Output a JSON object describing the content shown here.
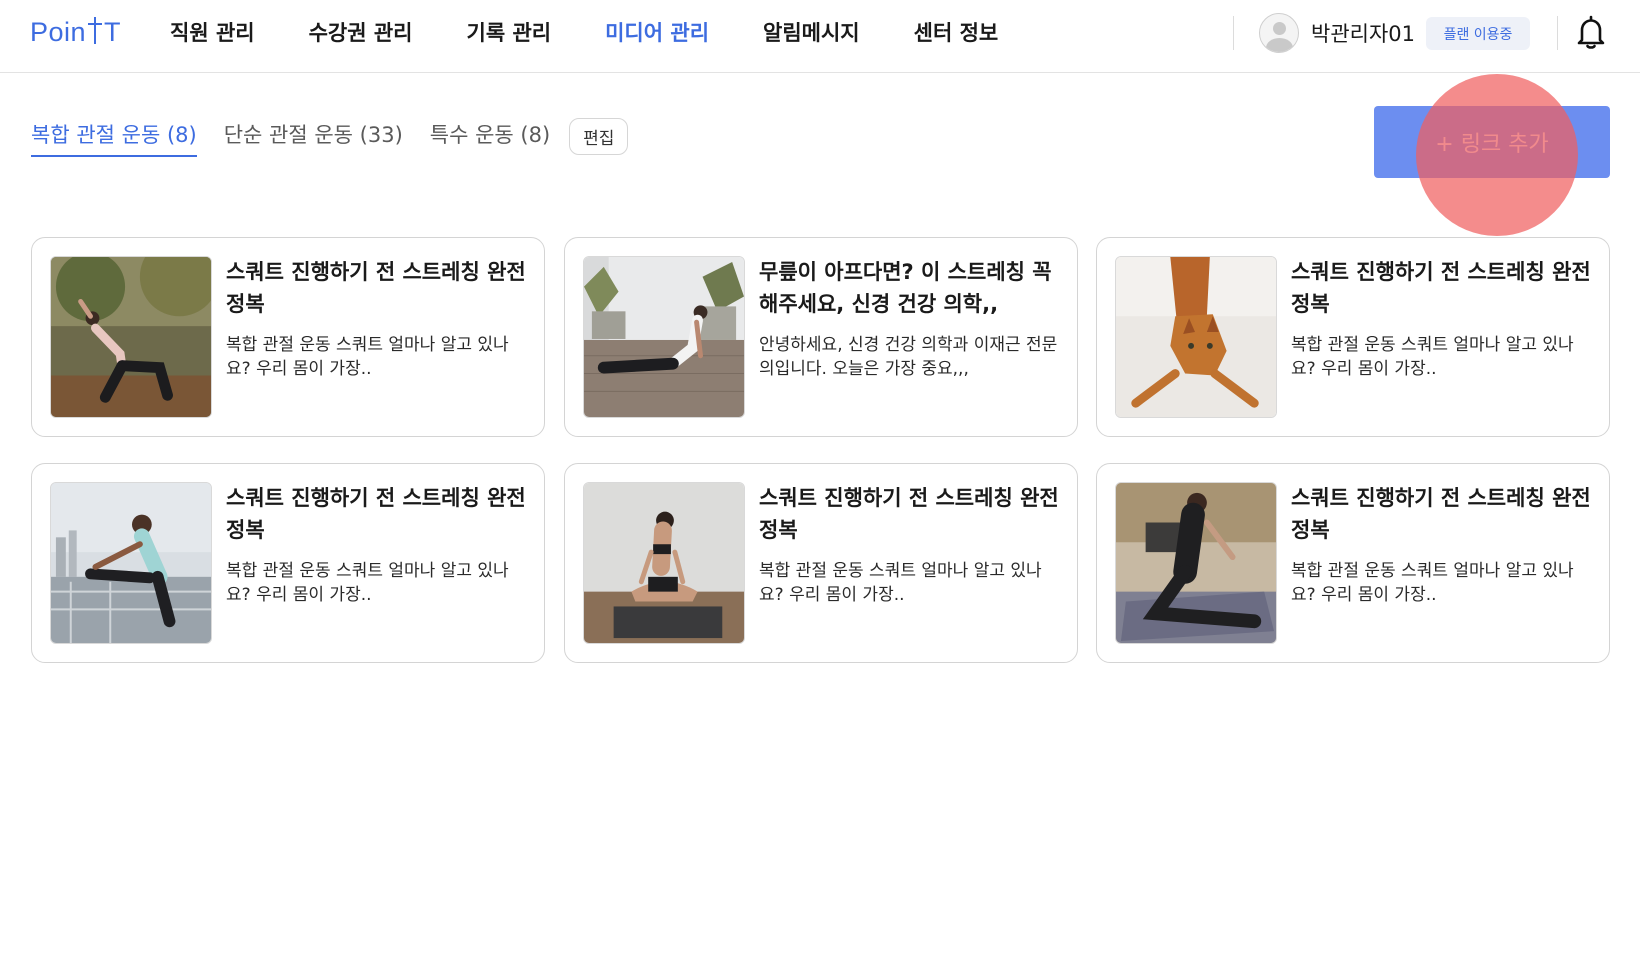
{
  "header": {
    "logo": "Poin T",
    "logo_left": "Poin",
    "logo_right": "T",
    "nav": [
      {
        "label": "직원 관리",
        "active": false
      },
      {
        "label": "수강권 관리",
        "active": false
      },
      {
        "label": "기록 관리",
        "active": false
      },
      {
        "label": "미디어 관리",
        "active": true
      },
      {
        "label": "알림메시지",
        "active": false
      },
      {
        "label": "센터 정보",
        "active": false
      }
    ],
    "user_name": "박관리자01",
    "plan_badge": "플랜 이용중",
    "bell_icon": "bell-icon"
  },
  "tabs": [
    {
      "label": "복합 관절 운동 (8)",
      "active": true
    },
    {
      "label": "단순 관절 운동 (33)",
      "active": false
    },
    {
      "label": "특수 운동 (8)",
      "active": false
    }
  ],
  "edit_label": "편집",
  "add_link_label": "+ 링크 추가",
  "cards": [
    {
      "title": "스쿼트 진행하기 전 스트레칭 완전 정복",
      "desc": "복합 관절 운동 스쿼트 얼마나 알고 있나요? 우리 몸이 가장..",
      "image": "woman-side-stretch-outdoors"
    },
    {
      "title": "무릎이 아프다면? 이 스트레칭 꼭 해주세요, 신경 건강 의학,,",
      "desc": "안녕하세요, 신경 건강 의학과 이재근 전문의입니다. 오늘은 가장 중요,,,",
      "image": "woman-cobra-pose-deck"
    },
    {
      "title": "스쿼트 진행하기 전 스트레칭 완전 정복",
      "desc": "복합 관절 운동 스쿼트 얼마나 알고 있나요? 우리 몸이 가장..",
      "image": "orange-cat-stretching"
    },
    {
      "title": "스쿼트 진행하기 전 스트레칭 완전 정복",
      "desc": "복합 관절 운동 스쿼트 얼마나 알고 있나요? 우리 몸이 가장..",
      "image": "man-hamstring-stretch-railing"
    },
    {
      "title": "스쿼트 진행하기 전 스트레칭 완전 정복",
      "desc": "복합 관절 운동 스쿼트 얼마나 알고 있나요? 우리 몸이 가장..",
      "image": "woman-seated-yoga-mat"
    },
    {
      "title": "스쿼트 진행하기 전 스트레칭 완전 정복",
      "desc": "복합 관절 운동 스쿼트 얼마나 알고 있나요? 우리 몸이 가장..",
      "image": "woman-stretching-on-mat"
    }
  ],
  "colors": {
    "accent": "#3d6ce0",
    "button_bg": "#6c8ef0",
    "click_overlay": "#f06060"
  }
}
